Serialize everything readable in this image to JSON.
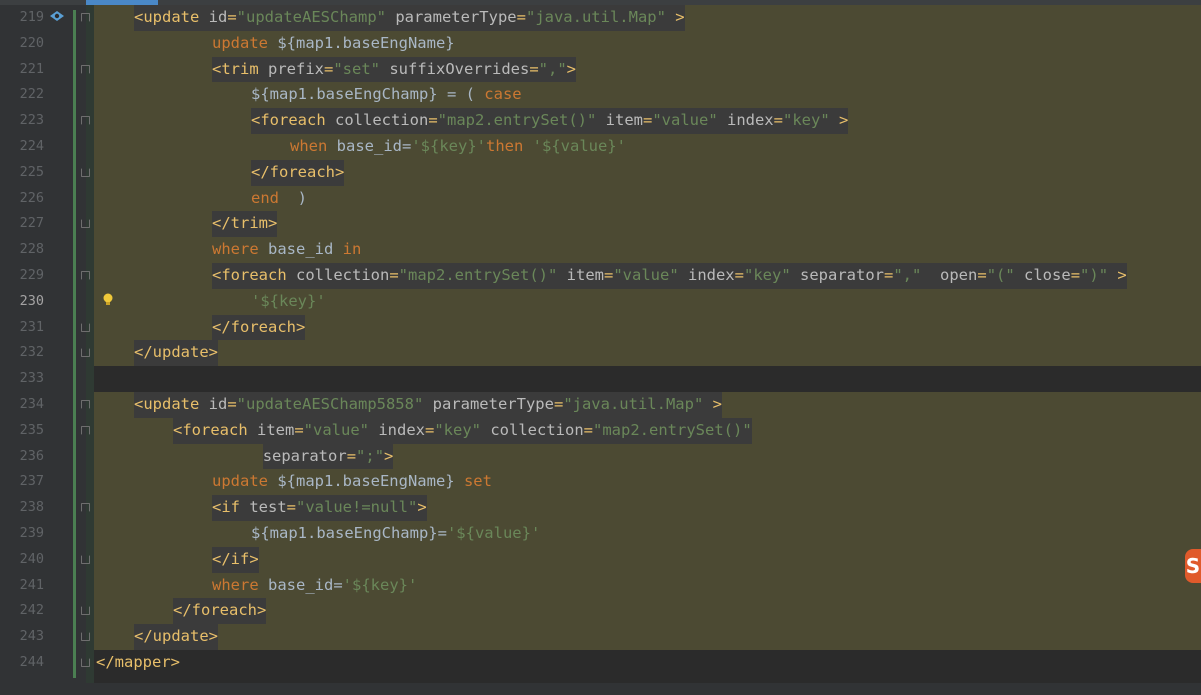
{
  "editor": {
    "active_line": 230,
    "lines": [
      {
        "n": "219",
        "segs": [
          [
            "tag",
            "<update "
          ],
          [
            "attr",
            "id"
          ],
          [
            "tag",
            "="
          ],
          [
            "val",
            "\"updateAESChamp\" "
          ],
          [
            "attr",
            "parameterType"
          ],
          [
            "tag",
            "="
          ],
          [
            "val",
            "\"java.util.Map\" "
          ],
          [
            "tag",
            ">"
          ]
        ]
      },
      {
        "n": "220",
        "segs": [
          [
            "kw",
            "update "
          ],
          [
            "txt",
            "${map1.baseEngName}"
          ]
        ]
      },
      {
        "n": "221",
        "segs": [
          [
            "tag",
            "<trim "
          ],
          [
            "attr",
            "prefix"
          ],
          [
            "tag",
            "="
          ],
          [
            "val",
            "\"set\" "
          ],
          [
            "attr",
            "suffixOverrides"
          ],
          [
            "tag",
            "="
          ],
          [
            "val",
            "\",\""
          ],
          [
            "tag",
            ">"
          ]
        ]
      },
      {
        "n": "222",
        "segs": [
          [
            "txt",
            "${map1.baseEngChamp} = ( "
          ],
          [
            "kw",
            "case"
          ]
        ]
      },
      {
        "n": "223",
        "segs": [
          [
            "tag",
            "<foreach "
          ],
          [
            "attr",
            "collection"
          ],
          [
            "tag",
            "="
          ],
          [
            "val",
            "\"map2.entrySet()\" "
          ],
          [
            "attr",
            "item"
          ],
          [
            "tag",
            "="
          ],
          [
            "val",
            "\"value\" "
          ],
          [
            "attr",
            "index"
          ],
          [
            "tag",
            "="
          ],
          [
            "val",
            "\"key\" "
          ],
          [
            "tag",
            ">"
          ]
        ]
      },
      {
        "n": "224",
        "segs": [
          [
            "kw",
            "when "
          ],
          [
            "txt",
            "base_id="
          ],
          [
            "val",
            "'${key}'"
          ],
          [
            "kw",
            "then "
          ],
          [
            "val",
            "'${value}'"
          ]
        ]
      },
      {
        "n": "225",
        "segs": [
          [
            "tag",
            "</foreach>"
          ]
        ]
      },
      {
        "n": "226",
        "segs": [
          [
            "kw",
            "end  "
          ],
          [
            "txt",
            ")"
          ]
        ]
      },
      {
        "n": "227",
        "segs": [
          [
            "tag",
            "</trim>"
          ]
        ]
      },
      {
        "n": "228",
        "segs": [
          [
            "kw",
            "where "
          ],
          [
            "txt",
            "base_id "
          ],
          [
            "kw",
            "in"
          ]
        ]
      },
      {
        "n": "229",
        "segs": [
          [
            "tag",
            "<foreach "
          ],
          [
            "attr",
            "collection"
          ],
          [
            "tag",
            "="
          ],
          [
            "val",
            "\"map2.entrySet()\" "
          ],
          [
            "attr",
            "item"
          ],
          [
            "tag",
            "="
          ],
          [
            "val",
            "\"value\" "
          ],
          [
            "attr",
            "index"
          ],
          [
            "tag",
            "="
          ],
          [
            "val",
            "\"key\" "
          ],
          [
            "attr",
            "separator"
          ],
          [
            "tag",
            "="
          ],
          [
            "val",
            "\",\"  "
          ],
          [
            "attr",
            "open"
          ],
          [
            "tag",
            "="
          ],
          [
            "val",
            "\"(\" "
          ],
          [
            "attr",
            "close"
          ],
          [
            "tag",
            "="
          ],
          [
            "val",
            "\")\" "
          ],
          [
            "tag",
            ">"
          ]
        ]
      },
      {
        "n": "230",
        "segs": [
          [
            "val",
            "'${key}'"
          ]
        ]
      },
      {
        "n": "231",
        "segs": [
          [
            "tag",
            "</foreach>"
          ]
        ]
      },
      {
        "n": "232",
        "segs": [
          [
            "tag",
            "</update>"
          ]
        ]
      },
      {
        "n": "233",
        "segs": []
      },
      {
        "n": "234",
        "segs": [
          [
            "tag",
            "<update "
          ],
          [
            "attr",
            "id"
          ],
          [
            "tag",
            "="
          ],
          [
            "val",
            "\"updateAESChamp5858\" "
          ],
          [
            "attr",
            "parameterType"
          ],
          [
            "tag",
            "="
          ],
          [
            "val",
            "\"java.util.Map\" "
          ],
          [
            "tag",
            ">"
          ]
        ]
      },
      {
        "n": "235",
        "segs": [
          [
            "tag",
            "<foreach "
          ],
          [
            "attr",
            "item"
          ],
          [
            "tag",
            "="
          ],
          [
            "val",
            "\"value\" "
          ],
          [
            "attr",
            "index"
          ],
          [
            "tag",
            "="
          ],
          [
            "val",
            "\"key\" "
          ],
          [
            "attr",
            "collection"
          ],
          [
            "tag",
            "="
          ],
          [
            "val",
            "\"map2.entrySet()\""
          ]
        ]
      },
      {
        "n": "236",
        "segs": [
          [
            "attr",
            "separator"
          ],
          [
            "tag",
            "="
          ],
          [
            "val",
            "\";\""
          ],
          [
            "tag",
            ">"
          ]
        ]
      },
      {
        "n": "237",
        "segs": [
          [
            "kw",
            "update "
          ],
          [
            "txt",
            "${map1.baseEngName} "
          ],
          [
            "kw",
            "set"
          ]
        ]
      },
      {
        "n": "238",
        "segs": [
          [
            "tag",
            "<if "
          ],
          [
            "attr",
            "test"
          ],
          [
            "tag",
            "="
          ],
          [
            "val",
            "\"value!=null\""
          ],
          [
            "tag",
            ">"
          ]
        ]
      },
      {
        "n": "239",
        "segs": [
          [
            "txt",
            "${map1.baseEngChamp}="
          ],
          [
            "val",
            "'${value}'"
          ]
        ]
      },
      {
        "n": "240",
        "segs": [
          [
            "tag",
            "</if>"
          ]
        ]
      },
      {
        "n": "241",
        "segs": [
          [
            "kw",
            "where "
          ],
          [
            "txt",
            "base_id="
          ],
          [
            "val",
            "'${key}'"
          ]
        ]
      },
      {
        "n": "242",
        "segs": [
          [
            "tag",
            "</foreach>"
          ]
        ]
      },
      {
        "n": "243",
        "segs": [
          [
            "tag",
            "</update>"
          ]
        ]
      },
      {
        "n": "244",
        "segs": [
          [
            "tag",
            "</mapper>"
          ]
        ]
      }
    ]
  },
  "icons": {
    "gutter": "run-breakpoint-icon",
    "intention": "lightbulb-icon",
    "watermark": "site-logo-icon"
  },
  "colors": {
    "background": "#2b2b2b",
    "gutter": "#313335",
    "highlight": "#4c4a33",
    "tag": "#e8bf6a",
    "attribute": "#bababa",
    "value": "#6a8759",
    "keyword": "#cc7832"
  }
}
